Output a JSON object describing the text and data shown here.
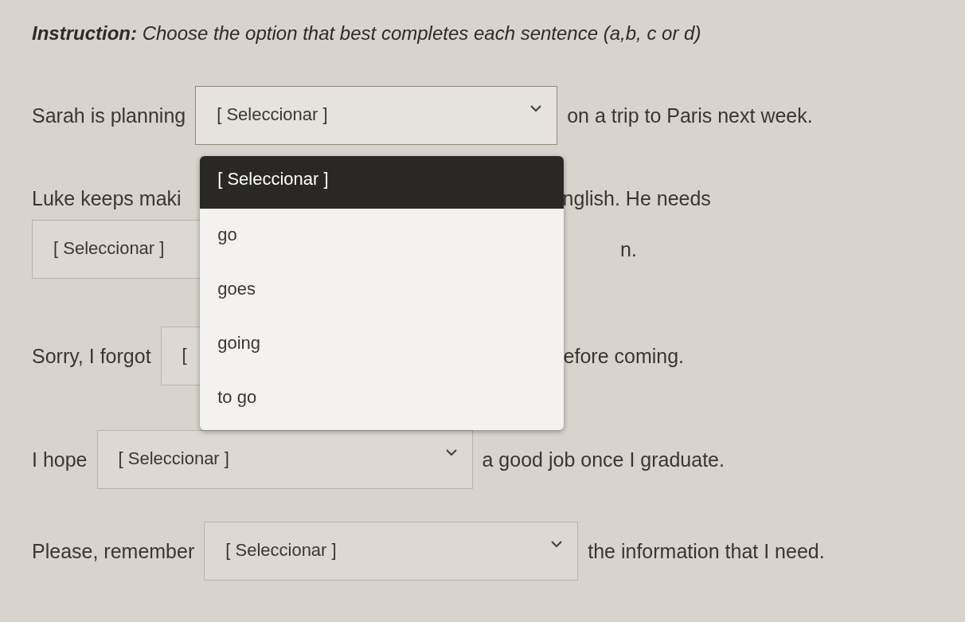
{
  "instruction": "**Instruction:** Choose the option that best completes each sentence (a,b, c or d)",
  "questions": [
    {
      "parts": [
        {
          "kind": "text",
          "text": "Sarah is planning"
        },
        {
          "kind": "select",
          "value": "[ Seleccionar ]",
          "open": true,
          "chevron": true,
          "options": [
            {
              "label": "[ Seleccionar ]",
              "selected": true
            },
            {
              "label": "go",
              "selected": false
            },
            {
              "label": "goes",
              "selected": false
            },
            {
              "label": "going",
              "selected": false
            },
            {
              "label": "to go",
              "selected": false
            }
          ]
        },
        {
          "kind": "text",
          "text": "on a trip to Paris next week."
        }
      ]
    },
    {
      "parts": [
        {
          "kind": "text",
          "text": "Luke keeps maki"
        },
        {
          "kind": "hidden"
        },
        {
          "kind": "text",
          "text": "nglish. He needs"
        },
        {
          "kind": "break"
        },
        {
          "kind": "select",
          "value": "[ Seleccionar ]",
          "open": false
        },
        {
          "kind": "hidden"
        },
        {
          "kind": "text",
          "text": "n."
        }
      ]
    },
    {
      "parts": [
        {
          "kind": "text",
          "text": "Sorry, I forgot"
        },
        {
          "kind": "select",
          "value": "[",
          "open": false
        },
        {
          "kind": "text",
          "text": "efore coming."
        }
      ]
    },
    {
      "parts": [
        {
          "kind": "text",
          "text": "I hope"
        },
        {
          "kind": "select",
          "value": "[ Seleccionar ]",
          "open": false,
          "chevron": true
        },
        {
          "kind": "text",
          "text": "a good job once I graduate."
        }
      ]
    },
    {
      "parts": [
        {
          "kind": "text",
          "text": "Please, remember"
        },
        {
          "kind": "select",
          "value": "[ Seleccionar ]",
          "open": false,
          "chevron": true
        },
        {
          "kind": "text",
          "text": "the information that I need."
        }
      ]
    }
  ]
}
